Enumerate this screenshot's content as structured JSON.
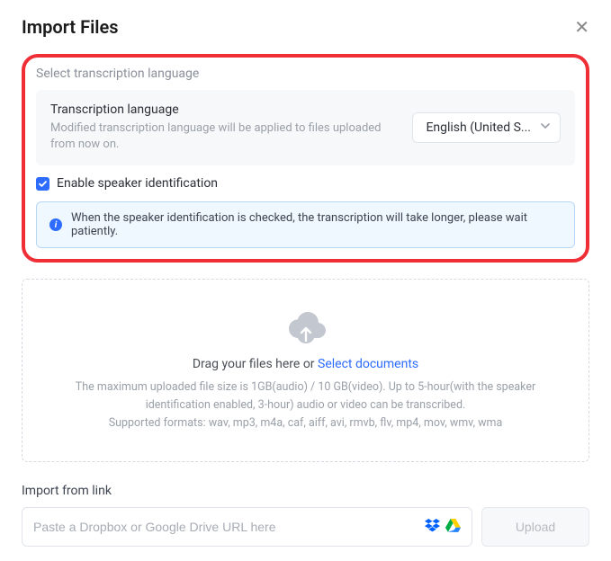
{
  "header": {
    "title": "Import Files"
  },
  "language_section": {
    "label": "Select transcription language",
    "row_title": "Transcription language",
    "row_desc": "Modified transcription language will be applied to files uploaded from now on.",
    "selected": "English (United S..."
  },
  "speaker": {
    "label": "Enable speaker identification",
    "checked": true,
    "info": "When the speaker identification is checked, the transcription will take longer, please wait patiently."
  },
  "dropzone": {
    "drag_prefix": "Drag your files here or  ",
    "select_link": "Select documents",
    "limits": "The maximum uploaded file size is 1GB(audio) / 10 GB(video). Up to 5-hour(with the speaker identification enabled, 3-hour) audio or video can be transcribed.",
    "formats": "Supported formats: wav, mp3, m4a, caf, aiff, avi, rmvb, flv, mp4, mov, wmv, wma"
  },
  "import_link": {
    "label": "Import from link",
    "placeholder": "Paste a Dropbox or Google Drive URL here",
    "upload_label": "Upload"
  }
}
